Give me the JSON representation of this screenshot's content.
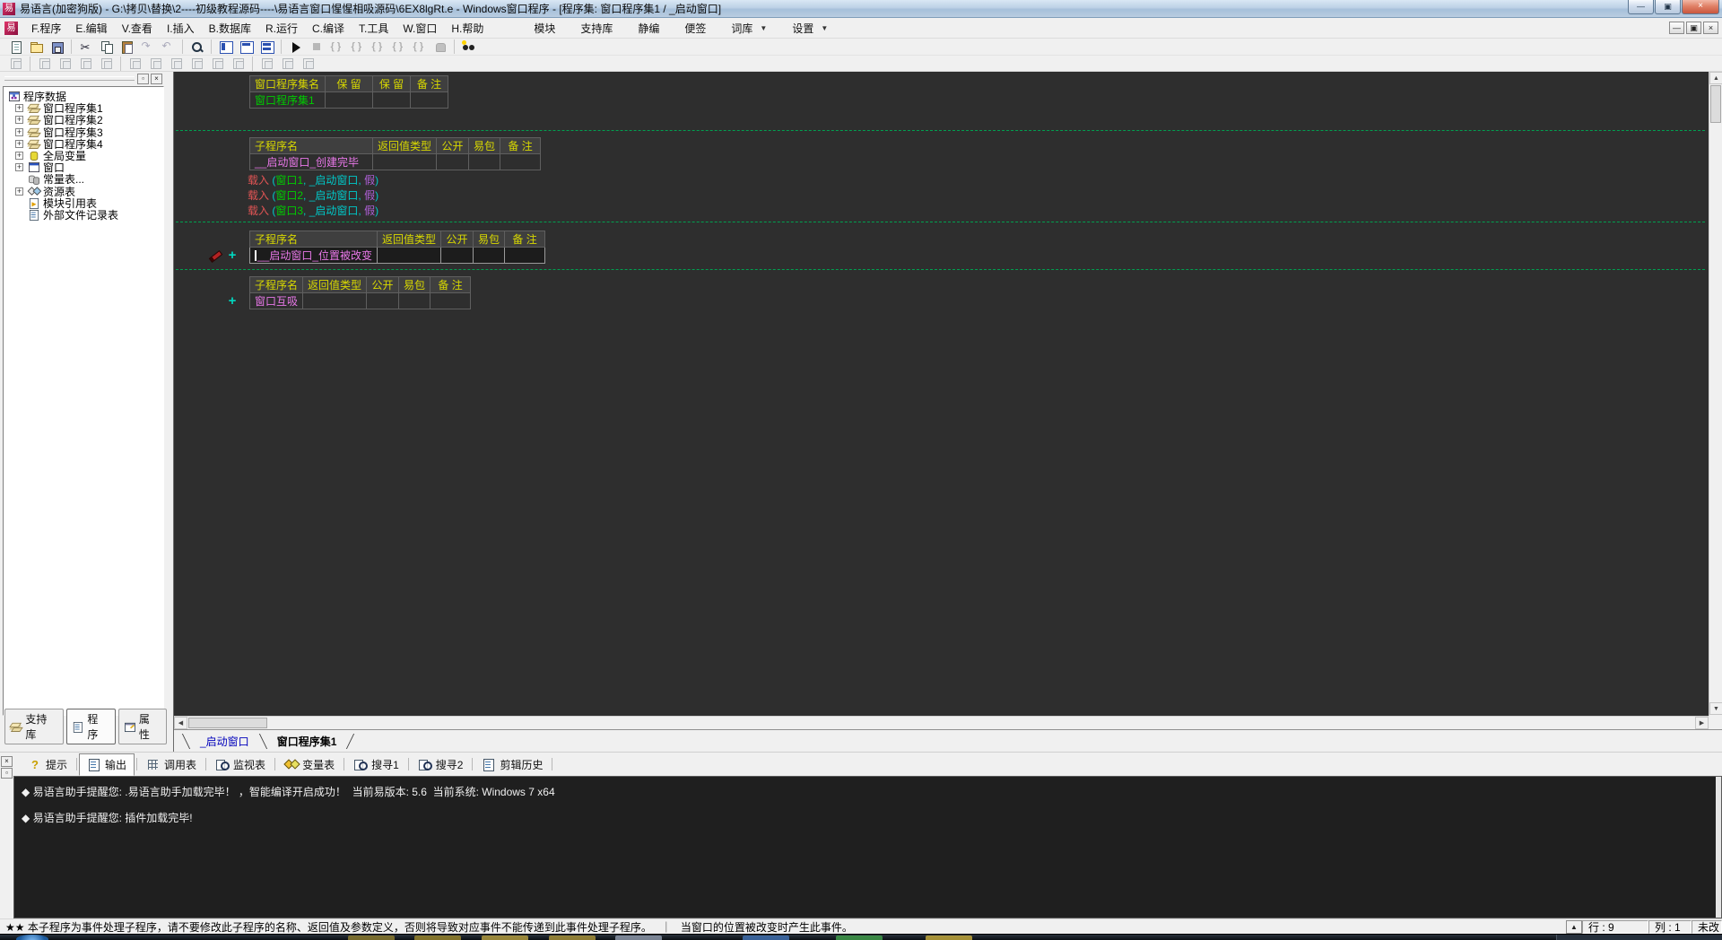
{
  "window": {
    "title": "易语言(加密狗版) - G:\\拷贝\\替换\\2----初级教程源码----\\易语言窗口惺惺相吸源码\\6EX8lgRt.e - Windows窗口程序 - [程序集: 窗口程序集1 / _启动窗口]"
  },
  "menu": {
    "items": [
      "F.程序",
      "E.编辑",
      "V.查看",
      "I.插入",
      "B.数据库",
      "R.运行",
      "C.编译",
      "T.工具",
      "W.窗口",
      "H.帮助"
    ],
    "tools": [
      {
        "label": "模块",
        "arrow": false
      },
      {
        "label": "支持库",
        "arrow": false
      },
      {
        "label": "静编",
        "arrow": false
      },
      {
        "label": "便签",
        "arrow": false
      },
      {
        "label": "词库",
        "arrow": true
      },
      {
        "label": "设置",
        "arrow": true
      }
    ]
  },
  "toolbar": {
    "row1": [
      "new",
      "open",
      "save",
      "|",
      "cut",
      "copy",
      "paste",
      "redo",
      "undo",
      "|",
      "find",
      "|",
      "view-code",
      "view-form",
      "view-split",
      "|",
      "run",
      "stop",
      "dbg-1",
      "dbg-2",
      "dbg-3",
      "dbg-4",
      "dbg-5",
      "hand",
      "|",
      "assist"
    ],
    "row2": [
      "al-1",
      "|",
      "al-2",
      "al-3",
      "al-4",
      "al-5",
      "|",
      "al-6",
      "al-7",
      "al-8",
      "al-9",
      "al-10",
      "al-11",
      "|",
      "al-12",
      "al-13",
      "al-14"
    ]
  },
  "sidebar": {
    "tree": {
      "root": {
        "label": "程序数据",
        "icon": "program-data"
      },
      "items": [
        {
          "label": "窗口程序集1",
          "icon": "window-module",
          "expandable": true
        },
        {
          "label": "窗口程序集2",
          "icon": "window-module",
          "expandable": true
        },
        {
          "label": "窗口程序集3",
          "icon": "window-module",
          "expandable": true
        },
        {
          "label": "窗口程序集4",
          "icon": "window-module",
          "expandable": true
        },
        {
          "label": "全局变量",
          "icon": "global-vars",
          "expandable": true
        },
        {
          "label": "窗口",
          "icon": "window",
          "expandable": true
        },
        {
          "label": "常量表...",
          "icon": "const-table",
          "expandable": false
        },
        {
          "label": "资源表",
          "icon": "resource-table",
          "expandable": true
        },
        {
          "label": "模块引用表",
          "icon": "module-ref",
          "expandable": false
        },
        {
          "label": "外部文件记录表",
          "icon": "external-files",
          "expandable": false
        }
      ]
    },
    "tabs": [
      {
        "label": "支持库",
        "icon": "support-lib",
        "active": false
      },
      {
        "label": "程序",
        "icon": "program",
        "active": true
      },
      {
        "label": "属性",
        "icon": "properties",
        "active": false
      }
    ]
  },
  "editor": {
    "tables": [
      {
        "headers": [
          "窗口程序集名",
          "保 留",
          "保 留",
          "备 注"
        ],
        "rows": [
          [
            "窗口程序集1",
            "",
            "",
            ""
          ]
        ],
        "row_color": "green",
        "editing": false
      },
      {
        "headers": [
          "子程序名",
          "返回值类型",
          "公开",
          "易包",
          "备 注"
        ],
        "rows": [
          [
            "__启动窗口_创建完毕",
            "",
            "",
            "",
            ""
          ]
        ],
        "row_color": "pink",
        "editing": false
      },
      {
        "headers": [
          "子程序名",
          "返回值类型",
          "公开",
          "易包",
          "备 注"
        ],
        "rows": [
          [
            "__启动窗口_位置被改变",
            "",
            "",
            "",
            ""
          ]
        ],
        "row_color": "pink",
        "editing": true
      },
      {
        "headers": [
          "子程序名",
          "返回值类型",
          "公开",
          "易包",
          "备 注"
        ],
        "rows": [
          [
            "窗口互吸",
            "",
            "",
            "",
            ""
          ]
        ],
        "row_color": "pink",
        "editing": false
      }
    ],
    "code_lines": [
      [
        {
          "t": "载入 ",
          "c": "red"
        },
        {
          "t": "(",
          "c": "cyan"
        },
        {
          "t": "窗口1",
          "c": "green"
        },
        {
          "t": ", ",
          "c": "cyan"
        },
        {
          "t": "_启动窗口",
          "c": "cyan"
        },
        {
          "t": ", ",
          "c": "cyan"
        },
        {
          "t": "假",
          "c": "purple"
        },
        {
          "t": ")",
          "c": "cyan"
        }
      ],
      [
        {
          "t": "载入 ",
          "c": "red"
        },
        {
          "t": "(",
          "c": "cyan"
        },
        {
          "t": "窗口2",
          "c": "green"
        },
        {
          "t": ", ",
          "c": "cyan"
        },
        {
          "t": "_启动窗口",
          "c": "cyan"
        },
        {
          "t": ", ",
          "c": "cyan"
        },
        {
          "t": "假",
          "c": "purple"
        },
        {
          "t": ")",
          "c": "cyan"
        }
      ],
      [
        {
          "t": "载入 ",
          "c": "red"
        },
        {
          "t": "(",
          "c": "cyan"
        },
        {
          "t": "窗口3",
          "c": "green"
        },
        {
          "t": ", ",
          "c": "cyan"
        },
        {
          "t": "_启动窗口",
          "c": "cyan"
        },
        {
          "t": ", ",
          "c": "cyan"
        },
        {
          "t": "假",
          "c": "purple"
        },
        {
          "t": ")",
          "c": "cyan"
        }
      ]
    ],
    "tabs": [
      {
        "label": "_启动窗口",
        "active": false
      },
      {
        "label": "窗口程序集1",
        "active": true
      }
    ]
  },
  "bottom_panel": {
    "tabs": [
      {
        "label": "提示",
        "icon": "hint",
        "active": false
      },
      {
        "label": "输出",
        "icon": "output",
        "active": true
      },
      {
        "label": "调用表",
        "icon": "call-table",
        "active": false
      },
      {
        "label": "监视表",
        "icon": "watch-table",
        "active": false
      },
      {
        "label": "变量表",
        "icon": "var-table",
        "active": false
      },
      {
        "label": "搜寻1",
        "icon": "search1",
        "active": false
      },
      {
        "label": "搜寻2",
        "icon": "search2",
        "active": false
      },
      {
        "label": "剪辑历史",
        "icon": "clip-history",
        "active": false
      }
    ],
    "output_lines": [
      "◆ 易语言助手提醒您: .易语言助手加载完毕！ ，智能编译开启成功！  当前易版本: 5.6  当前系统: Windows 7 x64",
      "◆ 易语言助手提醒您: 插件加载完毕!"
    ]
  },
  "status_bar": {
    "message": "★★ 本子程序为事件处理子程序，请不要修改此子程序的名称、返回值及参数定义，否则将导致对应事件不能传递到此事件处理子程序。",
    "event_hint": "当窗口的位置被改变时产生此事件。",
    "line_label": "行 : 9",
    "col_label": "列 : 1",
    "modified": "未改"
  },
  "colors": {
    "syntax_red": "#e05454",
    "syntax_cyan": "#00c8c8",
    "syntax_green": "#00cc00",
    "syntax_purple": "#b060d8",
    "syntax_pink": "#e878e8",
    "header_yellow": "#d8d800",
    "dashed_green": "#00a050"
  }
}
